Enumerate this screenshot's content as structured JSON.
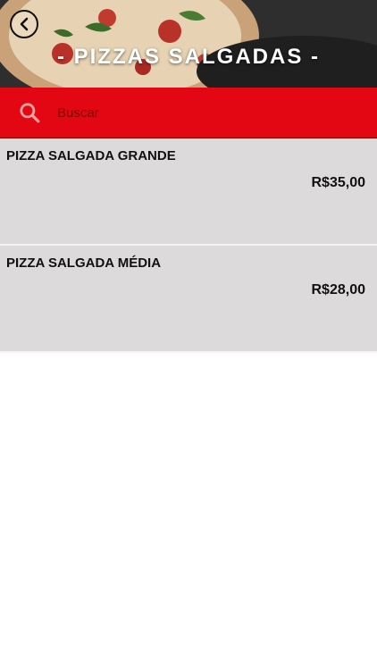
{
  "header": {
    "title": "- PIZZAS SALGADAS -",
    "back_icon": "chevron-left-circle-icon",
    "background_image": "pizza-photo"
  },
  "search": {
    "placeholder": "Buscar",
    "value": "",
    "icon": "search-icon",
    "bar_color": "#e30613"
  },
  "items": [
    {
      "name": "PIZZA SALGADA GRANDE",
      "price": "R$35,00"
    },
    {
      "name": "PIZZA SALGADA MÉDIA",
      "price": "R$28,00"
    }
  ]
}
